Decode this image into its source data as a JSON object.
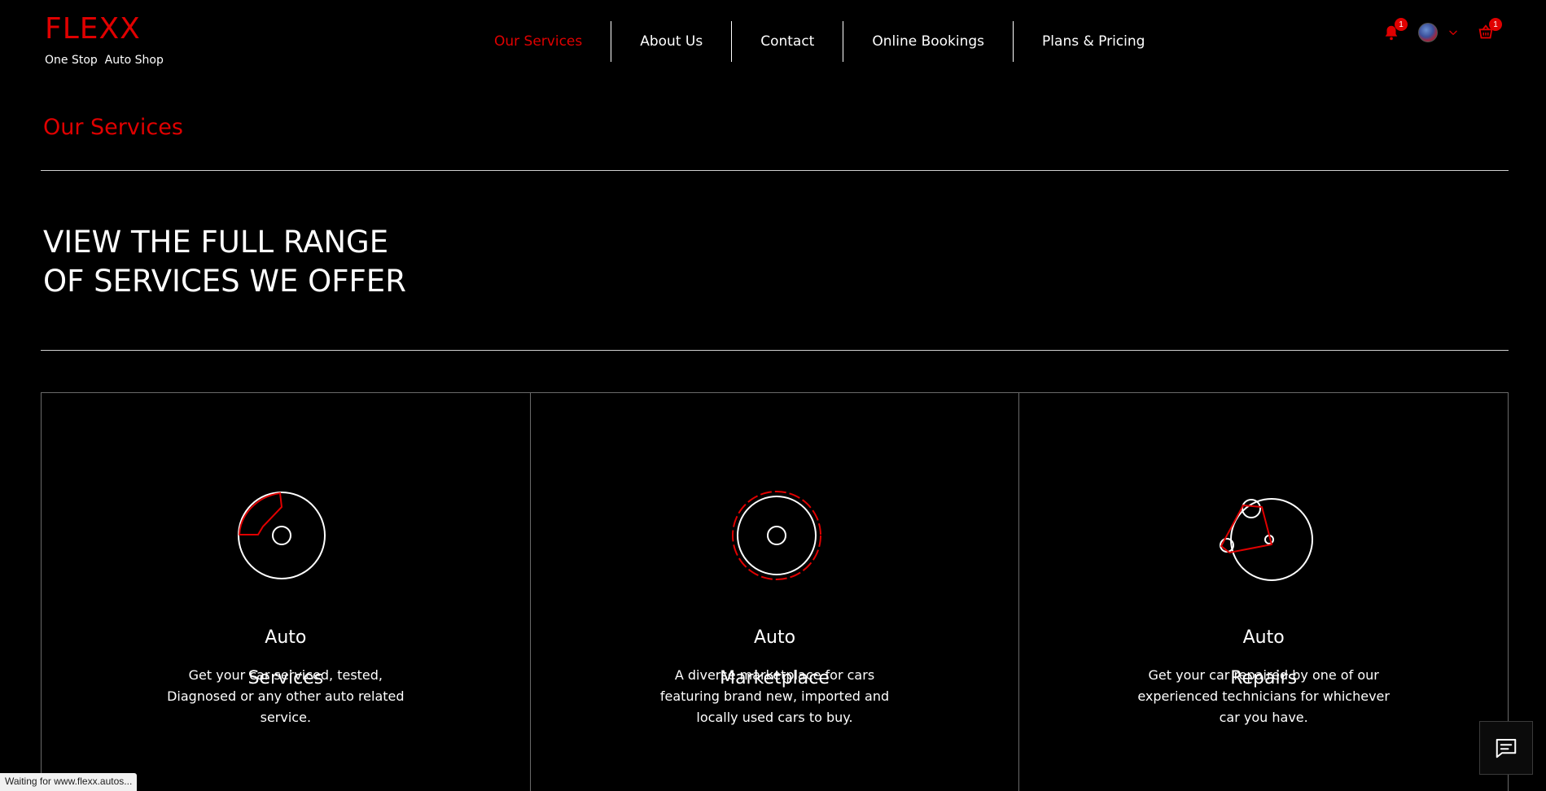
{
  "header": {
    "brand_name": "FLEXX",
    "tagline": "One Stop  Auto Shop",
    "nav": [
      {
        "label": "Our Services",
        "active": true
      },
      {
        "label": "About Us"
      },
      {
        "label": "Contact"
      },
      {
        "label": "Online Bookings"
      },
      {
        "label": "Plans & Pricing"
      }
    ],
    "notifications_count": "1",
    "cart_count": "1"
  },
  "section": {
    "title": "Our Services",
    "headline_line1": "VIEW THE FULL RANGE",
    "headline_line2": "OF SERVICES WE OFFER"
  },
  "services": [
    {
      "title_line1": "Auto",
      "title_line2": "Services",
      "description": "Get your car serviced, tested, Diagnosed or any other auto related service.",
      "icon": "tire-segment-icon"
    },
    {
      "title_line1": "Auto",
      "title_line2": "Marketplace",
      "description": "A diverse marketplace for cars featuring brand new, imported and locally used cars to buy.",
      "icon": "tire-ring-icon"
    },
    {
      "title_line1": "Auto",
      "title_line2": "Repairs",
      "description": "Get your car repaired by one of our experienced technicians for whichever car you have.",
      "icon": "belt-pulley-icon"
    }
  ],
  "status_bar": "Waiting for www.flexx.autos...",
  "colors": {
    "accent": "#e00000",
    "background": "#000000",
    "text": "#ffffff",
    "divider": "#cfcfcf"
  }
}
